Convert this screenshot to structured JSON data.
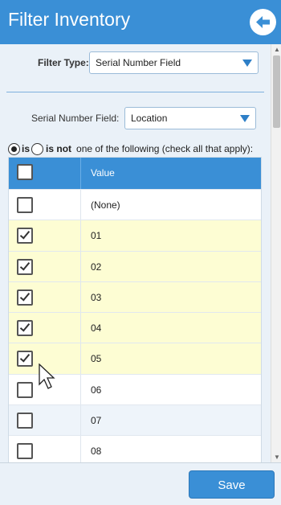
{
  "header": {
    "title": "Filter Inventory",
    "back_icon": "back-arrow-circle-icon"
  },
  "filter": {
    "type_label": "Filter Type:",
    "type_value": "Serial Number Field",
    "field_label": "Serial Number Field:",
    "field_value": "Location"
  },
  "mode": {
    "is_label": "is",
    "is_not_label": "is not",
    "suffix": "one of the following (check all that apply):",
    "selected": "is"
  },
  "table": {
    "value_header": "Value",
    "rows": [
      {
        "value": "(None)",
        "checked": false
      },
      {
        "value": "01",
        "checked": true
      },
      {
        "value": "02",
        "checked": true
      },
      {
        "value": "03",
        "checked": true
      },
      {
        "value": "04",
        "checked": true
      },
      {
        "value": "05",
        "checked": true
      },
      {
        "value": "06",
        "checked": false
      },
      {
        "value": "07",
        "checked": false
      },
      {
        "value": "08",
        "checked": false
      }
    ]
  },
  "footer": {
    "save_label": "Save"
  },
  "colors": {
    "primary": "#3a8fd6",
    "checked_row": "#fdfdd3",
    "background": "#eaf1f8"
  }
}
